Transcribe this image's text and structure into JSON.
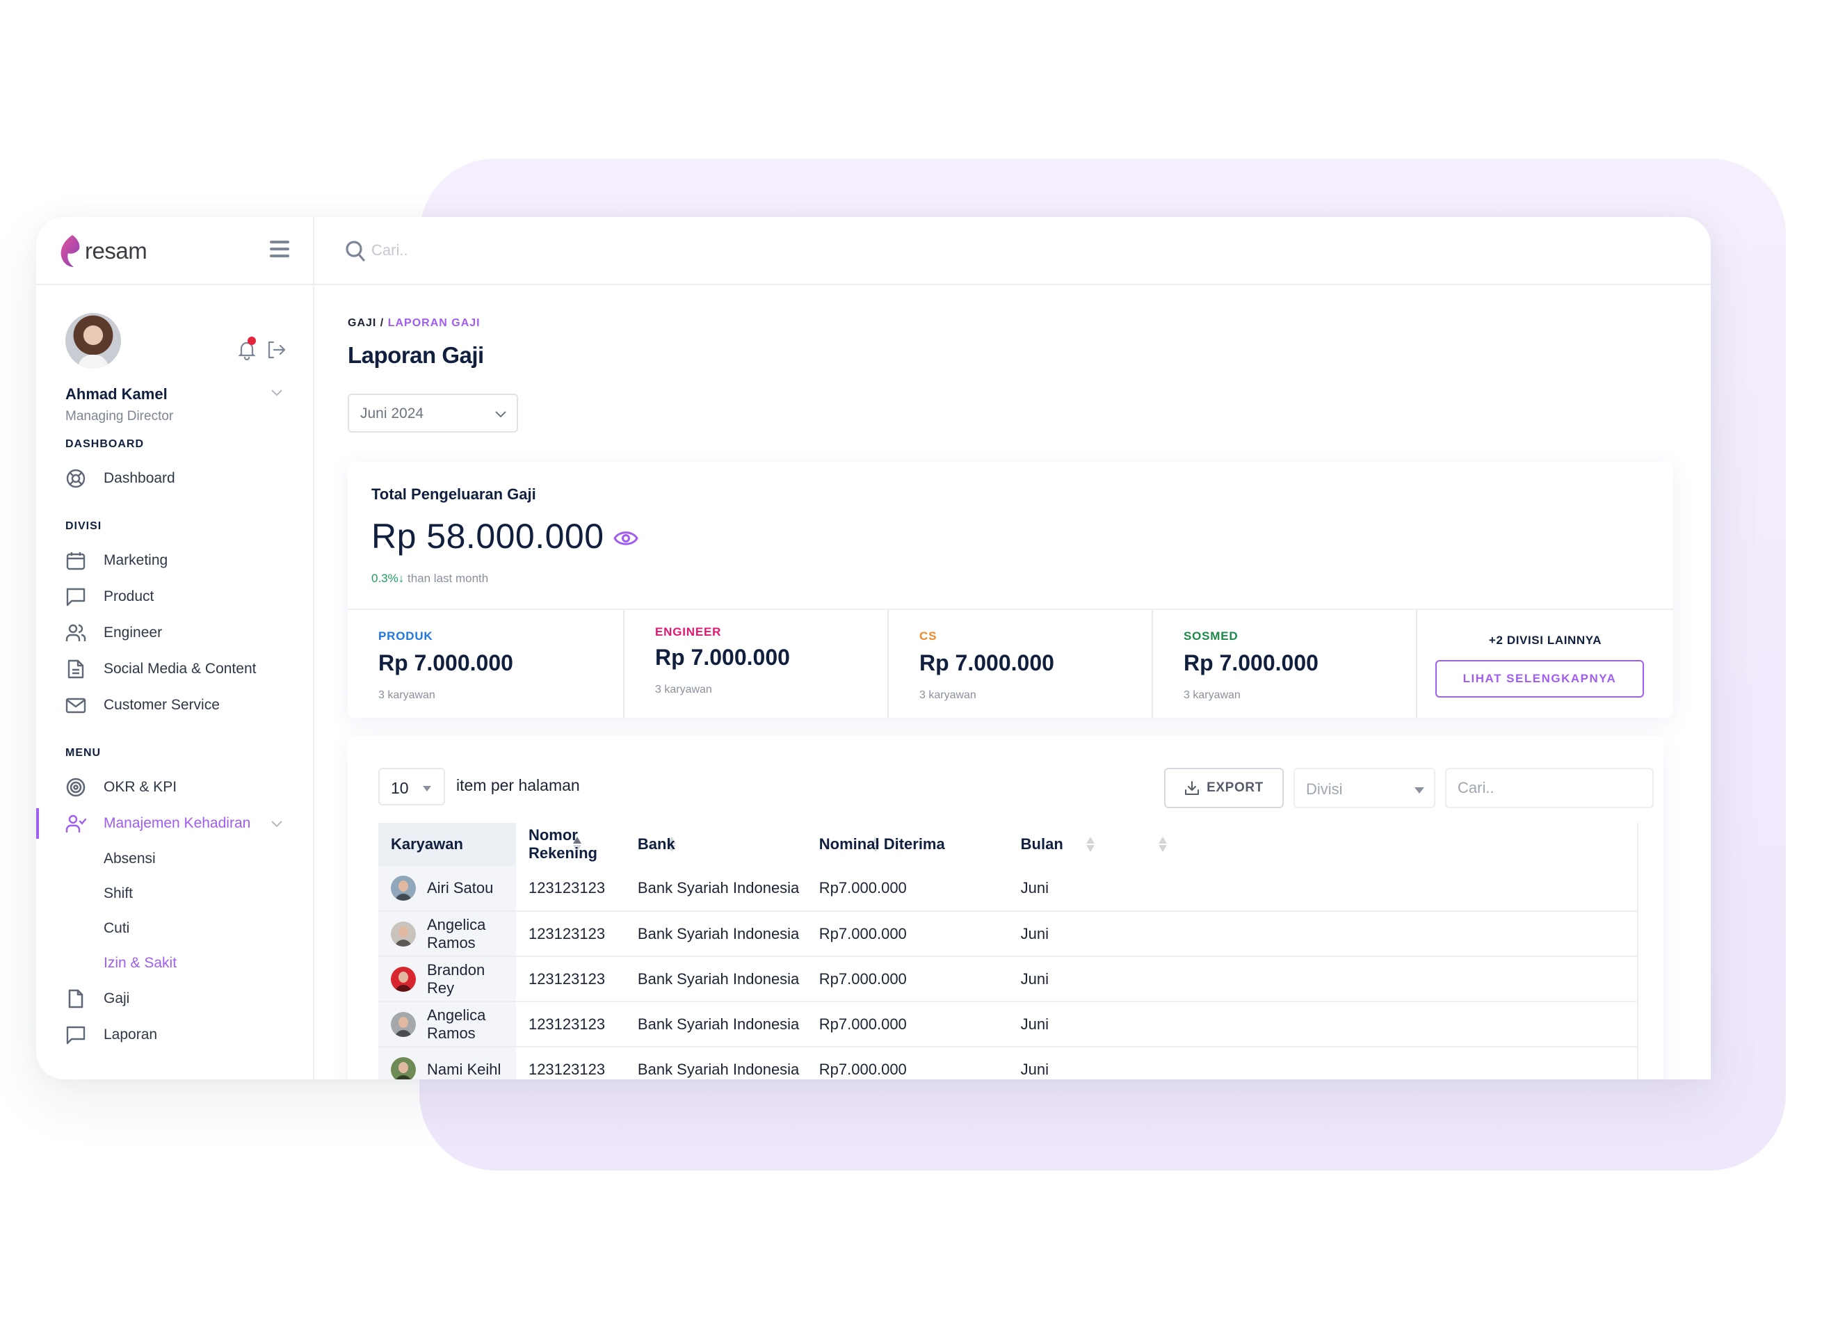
{
  "brand": {
    "name": "resam",
    "logo_gradient": [
      "#e0569b",
      "#8a3fb6"
    ]
  },
  "colors": {
    "accent": "#a05df1",
    "positive": "#1e9e5a",
    "notification_dot": "#e5253b",
    "produk": "#1f77e0",
    "engineer": "#e3176f",
    "cs": "#f0882a",
    "sosmed": "#1c8a4b"
  },
  "sidebar": {
    "user": {
      "name": "Ahmad Kamel",
      "role": "Managing Director",
      "has_notification": true
    },
    "sections": [
      {
        "title": "DASHBOARD",
        "items": [
          {
            "label": "Dashboard",
            "icon": "lifebuoy-icon"
          }
        ]
      },
      {
        "title": "DIVISI",
        "items": [
          {
            "label": "Marketing",
            "icon": "calendar-icon"
          },
          {
            "label": "Product",
            "icon": "chat-bubble-icon"
          },
          {
            "label": "Engineer",
            "icon": "users-icon"
          },
          {
            "label": "Social Media & Content",
            "icon": "document-icon"
          },
          {
            "label": "Customer Service",
            "icon": "mail-icon"
          }
        ]
      },
      {
        "title": "MENU",
        "items": [
          {
            "label": "OKR & KPI",
            "icon": "target-icon"
          },
          {
            "label": "Manajemen Kehadiran",
            "icon": "user-check-icon",
            "active": true,
            "expanded": true,
            "children": [
              {
                "label": "Absensi"
              },
              {
                "label": "Shift"
              },
              {
                "label": "Cuti"
              },
              {
                "label": "Izin & Sakit",
                "active": true
              }
            ]
          },
          {
            "label": "Gaji",
            "icon": "file-icon"
          },
          {
            "label": "Laporan",
            "icon": "chat-bubble-icon"
          }
        ]
      }
    ]
  },
  "topbar": {
    "search_placeholder": "Cari.."
  },
  "page": {
    "breadcrumb": {
      "root": "GAJI",
      "separator": "/",
      "current": "LAPORAN GAJI"
    },
    "title": "Laporan Gaji",
    "month_select": "Juni 2024"
  },
  "summary": {
    "title": "Total Pengeluaran Gaji",
    "amount": "Rp 58.000.000",
    "delta_pct": "0.3%",
    "delta_direction": "down",
    "delta_suffix": "than last month",
    "divisions": [
      {
        "label": "PRODUK",
        "value": "Rp 7.000.000",
        "count": "3 karyawan",
        "color_key": "produk"
      },
      {
        "label": "ENGINEER",
        "value": "Rp 7.000.000",
        "count": "3 karyawan",
        "color_key": "engineer"
      },
      {
        "label": "CS",
        "value": "Rp 7.000.000",
        "count": "3 karyawan",
        "color_key": "cs"
      },
      {
        "label": "SOSMED",
        "value": "Rp 7.000.000",
        "count": "3 karyawan",
        "color_key": "sosmed"
      }
    ],
    "more": {
      "label": "+2 DIVISI LAINNYA",
      "button": "LIHAT SELENGKAPNYA"
    }
  },
  "table": {
    "per_page": "10",
    "per_page_label": "item per halaman",
    "export_label": "EXPORT",
    "divisi_placeholder": "Divisi",
    "search_placeholder": "Cari..",
    "columns": [
      {
        "label": "Karyawan",
        "sort": "asc"
      },
      {
        "label": "Nomor Rekening",
        "sort": "none"
      },
      {
        "label": "Bank",
        "sort": "none"
      },
      {
        "label": "Nominal Diterima",
        "sort": "none"
      },
      {
        "label": "Bulan",
        "sort": "none"
      }
    ],
    "rows": [
      {
        "name": "Airi Satou",
        "account": "123123123",
        "bank": "Bank Syariah Indonesia",
        "amount": "Rp7.000.000",
        "month": "Juni",
        "avatar_bg": "#8fa7b8"
      },
      {
        "name": "Angelica Ramos",
        "account": "123123123",
        "bank": "Bank Syariah Indonesia",
        "amount": "Rp7.000.000",
        "month": "Juni",
        "avatar_bg": "#c9c3bd"
      },
      {
        "name": "Brandon Rey",
        "account": "123123123",
        "bank": "Bank Syariah Indonesia",
        "amount": "Rp7.000.000",
        "month": "Juni",
        "avatar_bg": "#d8262e"
      },
      {
        "name": "Angelica Ramos",
        "account": "123123123",
        "bank": "Bank Syariah Indonesia",
        "amount": "Rp7.000.000",
        "month": "Juni",
        "avatar_bg": "#a5a8ab"
      },
      {
        "name": "Nami Keihl",
        "account": "123123123",
        "bank": "Bank Syariah Indonesia",
        "amount": "Rp7.000.000",
        "month": "Juni",
        "avatar_bg": "#6e8a55"
      }
    ]
  }
}
